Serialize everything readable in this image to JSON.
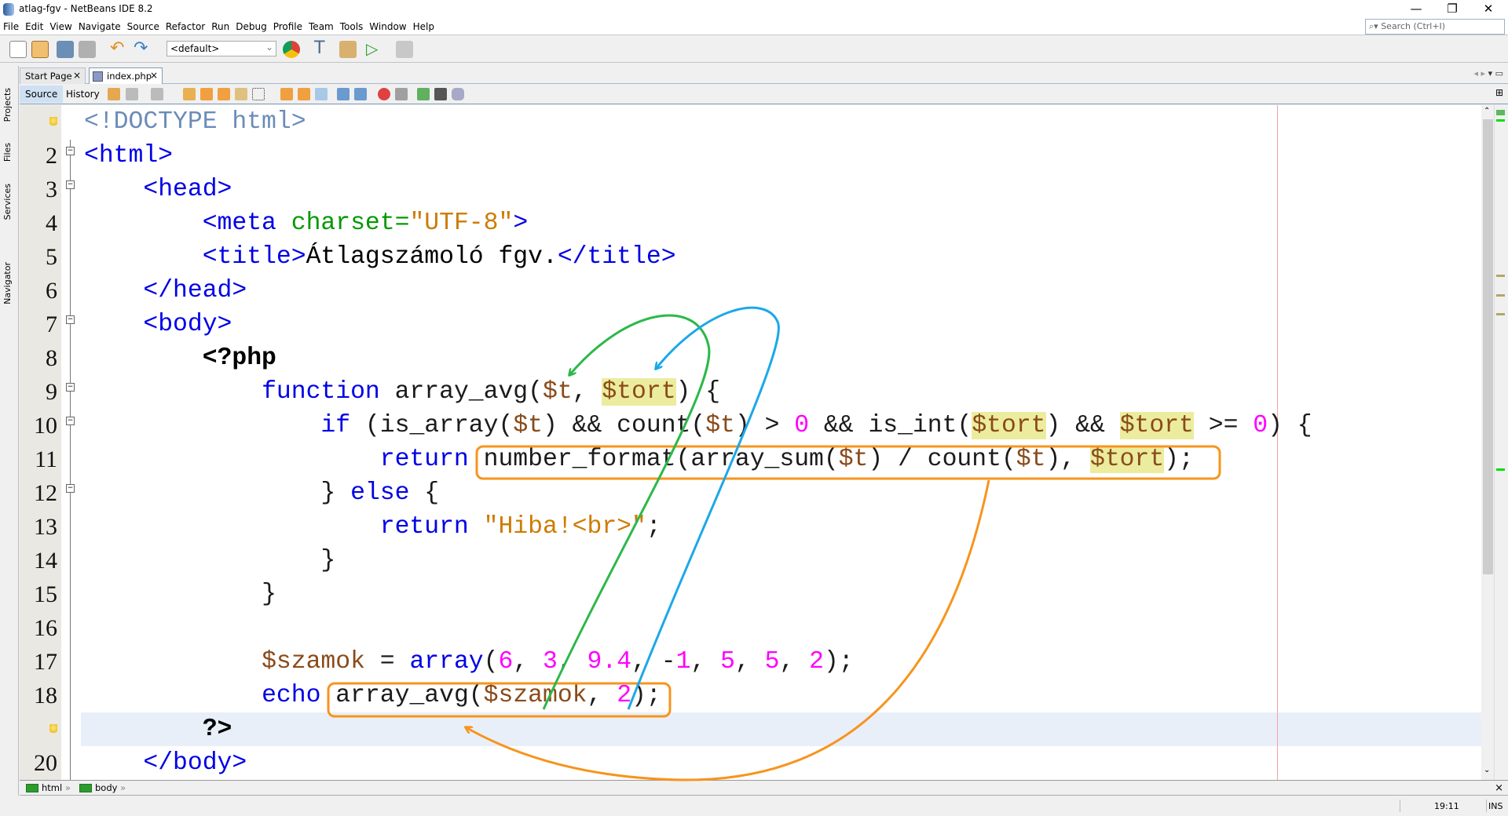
{
  "window": {
    "title": "atlag-fgv - NetBeans IDE 8.2",
    "minimize": "—",
    "restore": "❐",
    "close": "✕"
  },
  "menu": [
    "File",
    "Edit",
    "View",
    "Navigate",
    "Source",
    "Refactor",
    "Run",
    "Debug",
    "Profile",
    "Team",
    "Tools",
    "Window",
    "Help"
  ],
  "search": {
    "placeholder": "Search (Ctrl+I)"
  },
  "toolbar": {
    "config": "<default>"
  },
  "side_tabs": [
    "Projects",
    "Files",
    "Services",
    "Navigator"
  ],
  "tabs": [
    {
      "label": "Start Page",
      "active": false
    },
    {
      "label": "index.php",
      "active": true
    }
  ],
  "editor_tabs": {
    "source": "Source",
    "history": "History"
  },
  "code": {
    "lines": [
      {
        "num": "",
        "gutter_icon": "lightbulb-icon",
        "tokens": [
          {
            "t": "<!DOCTYPE html>",
            "c": "doc"
          }
        ]
      },
      {
        "num": "2",
        "fold": true,
        "tokens": [
          {
            "t": "<html>",
            "c": "tag"
          }
        ]
      },
      {
        "num": "3",
        "fold": true,
        "tokens": [
          {
            "t": "    "
          },
          {
            "t": "<head>",
            "c": "tag"
          }
        ]
      },
      {
        "num": "4",
        "tokens": [
          {
            "t": "        "
          },
          {
            "t": "<meta ",
            "c": "tag"
          },
          {
            "t": "charset=",
            "c": "attr"
          },
          {
            "t": "\"UTF-8\"",
            "c": "str"
          },
          {
            "t": ">",
            "c": "tag"
          }
        ]
      },
      {
        "num": "5",
        "tokens": [
          {
            "t": "        "
          },
          {
            "t": "<title>",
            "c": "tag"
          },
          {
            "t": "Átlagszámoló fgv.",
            "c": "pl"
          },
          {
            "t": "</title>",
            "c": "tag"
          }
        ]
      },
      {
        "num": "6",
        "tokens": [
          {
            "t": "    "
          },
          {
            "t": "</head>",
            "c": "tag"
          }
        ]
      },
      {
        "num": "7",
        "fold": true,
        "tokens": [
          {
            "t": "    "
          },
          {
            "t": "<body>",
            "c": "tag"
          }
        ]
      },
      {
        "num": "8",
        "tokens": [
          {
            "t": "        "
          },
          {
            "t": "<?php",
            "c": "php"
          }
        ]
      },
      {
        "num": "9",
        "fold": true,
        "tokens": [
          {
            "t": "            "
          },
          {
            "t": "function",
            "c": "kw"
          },
          {
            "t": " array_avg(",
            "c": "fn"
          },
          {
            "t": "$t",
            "c": "var"
          },
          {
            "t": ", ",
            "c": "fn"
          },
          {
            "t": "$tort",
            "c": "var hl"
          },
          {
            "t": ") {",
            "c": "fn"
          }
        ]
      },
      {
        "num": "10",
        "fold": true,
        "tokens": [
          {
            "t": "                "
          },
          {
            "t": "if",
            "c": "kw"
          },
          {
            "t": " (is_array(",
            "c": "fn"
          },
          {
            "t": "$t",
            "c": "var"
          },
          {
            "t": ") && count(",
            "c": "fn"
          },
          {
            "t": "$t",
            "c": "var"
          },
          {
            "t": ") > ",
            "c": "fn"
          },
          {
            "t": "0",
            "c": "num"
          },
          {
            "t": " && is_int(",
            "c": "fn"
          },
          {
            "t": "$tort",
            "c": "var hl"
          },
          {
            "t": ") && ",
            "c": "fn"
          },
          {
            "t": "$tort",
            "c": "var hl"
          },
          {
            "t": " >= ",
            "c": "fn"
          },
          {
            "t": "0",
            "c": "num"
          },
          {
            "t": ") {",
            "c": "fn"
          }
        ]
      },
      {
        "num": "11",
        "tokens": [
          {
            "t": "                    "
          },
          {
            "t": "return",
            "c": "kw"
          },
          {
            "t": " number_format(array_sum(",
            "c": "fn"
          },
          {
            "t": "$t",
            "c": "var"
          },
          {
            "t": ") / count(",
            "c": "fn"
          },
          {
            "t": "$t",
            "c": "var"
          },
          {
            "t": "), ",
            "c": "fn"
          },
          {
            "t": "$tort",
            "c": "var hl"
          },
          {
            "t": ");",
            "c": "fn"
          }
        ]
      },
      {
        "num": "12",
        "fold": true,
        "tokens": [
          {
            "t": "                "
          },
          {
            "t": "} ",
            "c": "fn"
          },
          {
            "t": "else",
            "c": "kw"
          },
          {
            "t": " {",
            "c": "fn"
          }
        ]
      },
      {
        "num": "13",
        "tokens": [
          {
            "t": "                    "
          },
          {
            "t": "return",
            "c": "kw"
          },
          {
            "t": " "
          },
          {
            "t": "\"Hiba!<br>\"",
            "c": "str"
          },
          {
            "t": ";",
            "c": "fn"
          }
        ]
      },
      {
        "num": "14",
        "tokens": [
          {
            "t": "                "
          },
          {
            "t": "}",
            "c": "fn"
          }
        ]
      },
      {
        "num": "15",
        "tokens": [
          {
            "t": "            "
          },
          {
            "t": "}",
            "c": "fn"
          }
        ]
      },
      {
        "num": "16",
        "tokens": []
      },
      {
        "num": "17",
        "tokens": [
          {
            "t": "            "
          },
          {
            "t": "$szamok",
            "c": "var"
          },
          {
            "t": " = ",
            "c": "fn"
          },
          {
            "t": "array",
            "c": "kw"
          },
          {
            "t": "(",
            "c": "fn"
          },
          {
            "t": "6",
            "c": "num"
          },
          {
            "t": ", ",
            "c": "fn"
          },
          {
            "t": "3",
            "c": "num"
          },
          {
            "t": ", ",
            "c": "fn"
          },
          {
            "t": "9.4",
            "c": "num"
          },
          {
            "t": ", -",
            "c": "fn"
          },
          {
            "t": "1",
            "c": "num"
          },
          {
            "t": ", ",
            "c": "fn"
          },
          {
            "t": "5",
            "c": "num"
          },
          {
            "t": ", ",
            "c": "fn"
          },
          {
            "t": "5",
            "c": "num"
          },
          {
            "t": ", ",
            "c": "fn"
          },
          {
            "t": "2",
            "c": "num"
          },
          {
            "t": ");",
            "c": "fn"
          }
        ]
      },
      {
        "num": "18",
        "tokens": [
          {
            "t": "            "
          },
          {
            "t": "echo",
            "c": "kw"
          },
          {
            "t": " array_avg(",
            "c": "fn"
          },
          {
            "t": "$szamok",
            "c": "var"
          },
          {
            "t": ", ",
            "c": "fn"
          },
          {
            "t": "2",
            "c": "num"
          },
          {
            "t": ");",
            "c": "fn"
          }
        ]
      },
      {
        "num": "",
        "gutter_icon": "lightbulb-icon",
        "current": true,
        "tokens": [
          {
            "t": "        "
          },
          {
            "t": "?>",
            "c": "php"
          }
        ]
      },
      {
        "num": "20",
        "tokens": [
          {
            "t": "    "
          },
          {
            "t": "</body>",
            "c": "tag"
          }
        ]
      }
    ]
  },
  "annotations": {
    "box_color": "#f7941d",
    "green": "#2db84a",
    "blue": "#1ba8e8",
    "orange": "#f7941d"
  },
  "breadcrumbs": [
    "html",
    "body"
  ],
  "status": {
    "position": "19:11",
    "mode": "INS"
  }
}
